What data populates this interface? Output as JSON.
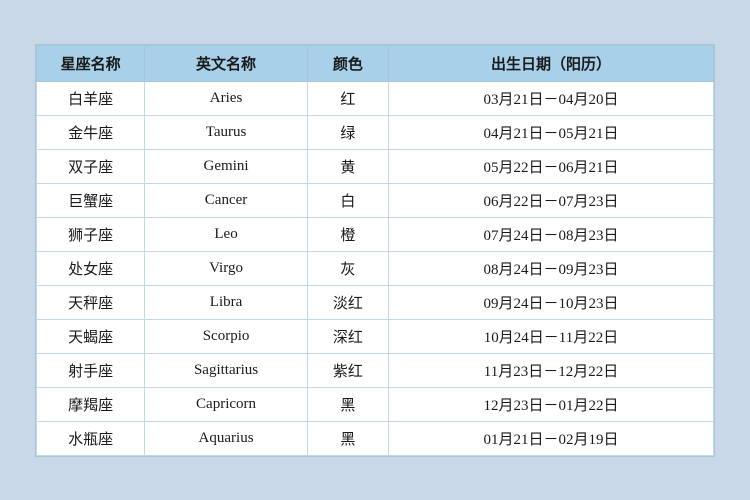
{
  "table": {
    "headers": [
      "星座名称",
      "英文名称",
      "颜色",
      "出生日期（阳历）"
    ],
    "rows": [
      {
        "chinese": "白羊座",
        "english": "Aries",
        "color": "红",
        "date": "03月21日－04月20日"
      },
      {
        "chinese": "金牛座",
        "english": "Taurus",
        "color": "绿",
        "date": "04月21日－05月21日"
      },
      {
        "chinese": "双子座",
        "english": "Gemini",
        "color": "黄",
        "date": "05月22日－06月21日"
      },
      {
        "chinese": "巨蟹座",
        "english": "Cancer",
        "color": "白",
        "date": "06月22日－07月23日"
      },
      {
        "chinese": "狮子座",
        "english": "Leo",
        "color": "橙",
        "date": "07月24日－08月23日"
      },
      {
        "chinese": "处女座",
        "english": "Virgo",
        "color": "灰",
        "date": "08月24日－09月23日"
      },
      {
        "chinese": "天秤座",
        "english": "Libra",
        "color": "淡红",
        "date": "09月24日－10月23日"
      },
      {
        "chinese": "天蝎座",
        "english": "Scorpio",
        "color": "深红",
        "date": "10月24日－11月22日"
      },
      {
        "chinese": "射手座",
        "english": "Sagittarius",
        "color": "紫红",
        "date": "11月23日－12月22日"
      },
      {
        "chinese": "摩羯座",
        "english": "Capricorn",
        "color": "黑",
        "date": "12月23日－01月22日"
      },
      {
        "chinese": "水瓶座",
        "english": "Aquarius",
        "color": "黑",
        "date": "01月21日－02月19日"
      }
    ]
  }
}
